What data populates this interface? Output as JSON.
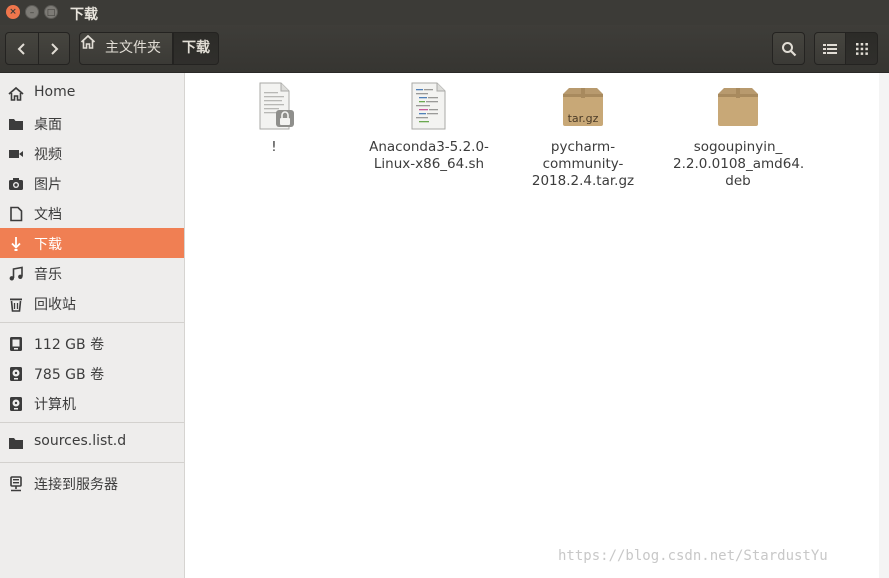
{
  "window": {
    "title": "下载",
    "controls": {
      "close": "×",
      "minimize": "–",
      "maximize": "□"
    }
  },
  "toolbar": {
    "back_icon": "chevron-left-icon",
    "forward_icon": "chevron-right-icon",
    "breadcrumb": [
      {
        "label": "主文件夹",
        "icon": "home-icon"
      },
      {
        "label": "下载",
        "current": true
      }
    ],
    "search_icon": "search-icon",
    "view_list_icon": "list-view-icon",
    "view_grid_icon": "grid-view-icon"
  },
  "sidebar": {
    "items": [
      {
        "label": "Home",
        "icon": "home-icon"
      },
      {
        "label": "桌面",
        "icon": "folder-icon"
      },
      {
        "label": "视频",
        "icon": "video-icon"
      },
      {
        "label": "图片",
        "icon": "camera-icon"
      },
      {
        "label": "文档",
        "icon": "document-icon"
      },
      {
        "label": "下载",
        "icon": "download-icon",
        "active": true
      },
      {
        "label": "音乐",
        "icon": "music-icon"
      },
      {
        "label": "回收站",
        "icon": "trash-icon"
      },
      {
        "label": "112 GB 卷",
        "icon": "drive-icon"
      },
      {
        "label": "785 GB 卷",
        "icon": "drive-icon"
      },
      {
        "label": "计算机",
        "icon": "computer-icon"
      },
      {
        "label": "sources.list.d",
        "icon": "folder-icon"
      },
      {
        "label": "连接到服务器",
        "icon": "network-server-icon"
      }
    ]
  },
  "files": [
    {
      "name_lines": [
        "!"
      ],
      "icon": "locked-text-file-icon"
    },
    {
      "name_lines": [
        "Anaconda3-5.2.0-",
        "Linux-x86_64.sh"
      ],
      "icon": "script-file-icon"
    },
    {
      "name_lines": [
        "pycharm-",
        "community-",
        "2018.2.4.tar.gz"
      ],
      "icon": "archive-icon",
      "badge": "tar.gz"
    },
    {
      "name_lines": [
        "sogoupinyin_",
        "2.2.0.0108_amd64.",
        "deb"
      ],
      "icon": "package-icon"
    }
  ],
  "watermark": "https://blog.csdn.net/StardustYu",
  "colors": {
    "accent": "#f07f53",
    "titlebar": "#3c3b37",
    "sidebar": "#eeedec"
  }
}
